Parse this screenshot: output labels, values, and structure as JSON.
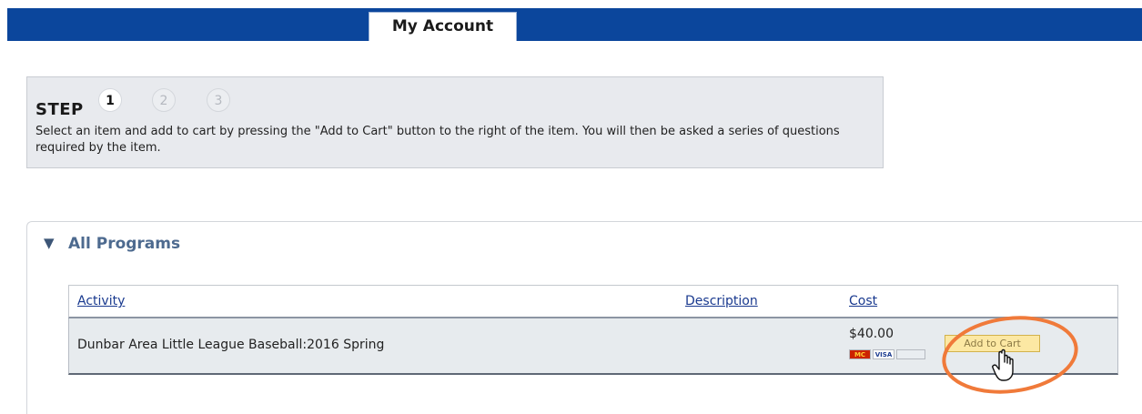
{
  "header": {
    "tab_label": "My Account"
  },
  "step_box": {
    "title": "STEP",
    "steps": [
      "1",
      "2",
      "3"
    ],
    "active_step": "1",
    "description": "Select an item and add to cart by pressing the \"Add to Cart\" button to the right of the item. You will then be asked a series of questions required by the item."
  },
  "programs": {
    "toggle_icon": "triangle-down-icon",
    "title": "All Programs",
    "columns": [
      "Activity",
      "Description",
      "Cost"
    ],
    "rows": [
      {
        "activity": "Dunbar Area Little League Baseball:2016 Spring",
        "description": "",
        "cost": "$40.00",
        "payment_icons": [
          "mastercard-icon",
          "visa-icon",
          "card-icon"
        ],
        "button_label": "Add to Cart"
      }
    ]
  },
  "colors": {
    "header_bar": "#0b469c",
    "annotation": "#f07a3a",
    "button_bg": "#fce8a3"
  }
}
